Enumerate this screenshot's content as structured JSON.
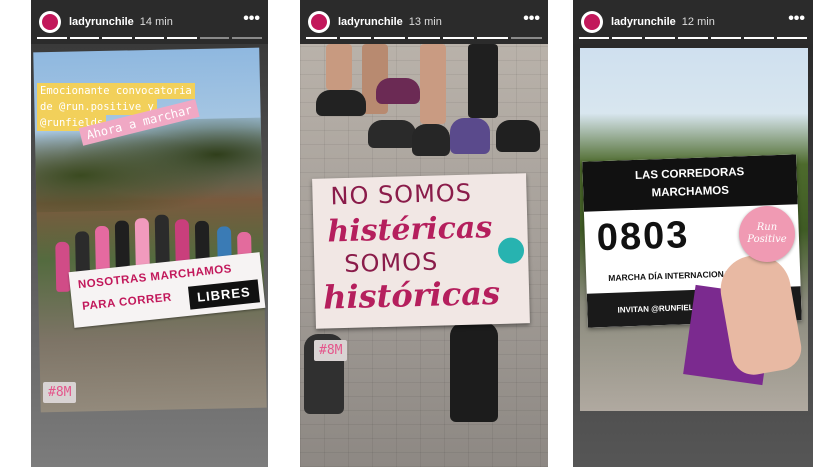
{
  "stories": [
    {
      "username": "ladyrunchile",
      "time": "14 min",
      "caption_lines": [
        "Emocionante convocatoria",
        "de @run.positive y",
        "@runfields"
      ],
      "pill_text": "Ahora a marchar",
      "banner_line1": "NOSOTRAS MARCHAMOS",
      "banner_line2": "PARA CORRER",
      "banner_highlight": "LIBRES",
      "hashtag": "#8M"
    },
    {
      "username": "ladyrunchile",
      "time": "13 min",
      "poster_line1": "NO SOMOS",
      "poster_line2": "histéricas",
      "poster_line3": "SOMOS",
      "poster_line4": "históricas",
      "hashtag": "#8M"
    },
    {
      "username": "ladyrunchile",
      "time": "12 min",
      "bib_line1": "LAS CORREDORAS",
      "bib_line2": "MARCHAMOS",
      "bib_number": "0803",
      "bib_event": "MARCHA DÍA INTERNACIONAL DE LA MU",
      "bib_inviters": "INVITAN @RUNFIELDS @RUN.POSITIVE",
      "badge_line1": "Run",
      "badge_line2": "Positive"
    }
  ],
  "colors": {
    "story_bg": "#2b2b2b",
    "accent_pink": "#c2185b",
    "caption_yellow": "#f2d05a",
    "pill_pink": "#f0a8c4"
  },
  "icons": {
    "more": "more-horizontal-icon",
    "avatar": "profile-avatar"
  }
}
